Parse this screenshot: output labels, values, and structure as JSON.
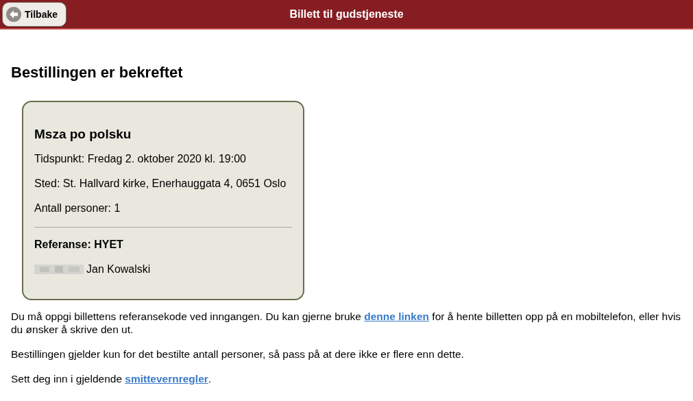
{
  "header": {
    "back_button": "Tilbake",
    "title": "Billett til gudstjeneste"
  },
  "heading": "Bestillingen er bekreftet",
  "ticket": {
    "title": "Msza po polsku",
    "details": [
      "Tidspunkt: Fredag 2. oktober 2020 kl. 19:00",
      "Sted: St. Hallvard kirke, Enerhauggata 4, 0651 Oslo",
      "Antall personer: 1"
    ],
    "reference": "Referanse: HYET",
    "name": "Jan Kowalski"
  },
  "paragraphs": [
    {
      "before": "Du må oppgi billettens referansekode ved inngangen. Du kan gjerne bruke ",
      "link": "denne linken",
      "after": " for å hente billetten opp på en mobiltelefon, eller hvis du ønsker å skrive den ut."
    },
    {
      "before": "Bestillingen gjelder kun for det bestilte antall personer, så pass på at dere ikke er flere enn dette."
    },
    {
      "before": "Sett deg inn i gjeldende ",
      "link": "smittevernregler",
      "after": "."
    }
  ]
}
